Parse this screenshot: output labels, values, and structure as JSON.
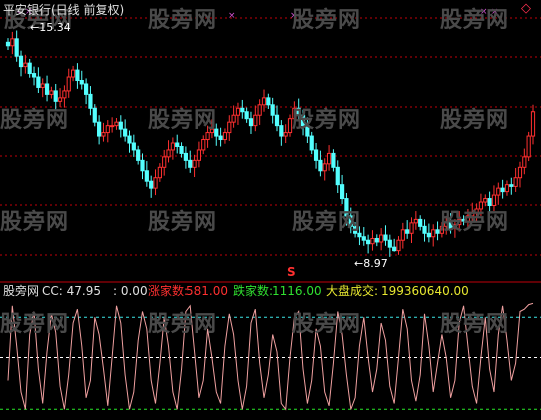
{
  "header": {
    "title": "平安银行(日线 前复权)",
    "high_label": "15.34",
    "low_label": "8.97",
    "sell_mark": "S",
    "diamond_icon": "diamond-outline-icon"
  },
  "indicator_bar": {
    "name": "股旁网",
    "cc_label": "CC: 47.95",
    "zero_label": ": 0.00",
    "up_label": "涨家数:",
    "up_value": "581.00",
    "down_label": "跌家数:",
    "down_value": "1116.00",
    "vol_label": "大盘成交:",
    "vol_value": "199360640.00"
  },
  "watermark": "股旁网",
  "colors": {
    "up_candle": "#ff3030",
    "down_candle": "#54ffff",
    "ref_line": "#c0000a",
    "osc_line": "#f0a0a0",
    "upper_band": "#3ce6e6",
    "lower_band": "#28e628",
    "mid_band": "#ffffff"
  },
  "chart_data": [
    {
      "type": "candlestick",
      "title": "平安银行(日线 前复权)",
      "ylim": [
        8.5,
        15.7
      ],
      "grid": true,
      "high": 15.34,
      "low": 8.97,
      "closes": [
        14.9,
        15.1,
        14.6,
        14.3,
        14.4,
        14.1,
        14.0,
        13.7,
        13.8,
        13.5,
        13.6,
        13.3,
        13.4,
        13.6,
        14.0,
        14.2,
        13.9,
        13.8,
        13.5,
        13.1,
        12.7,
        12.3,
        12.4,
        12.6,
        12.6,
        12.7,
        12.5,
        12.3,
        12.1,
        11.9,
        11.6,
        11.3,
        11.0,
        10.8,
        11.1,
        11.4,
        11.7,
        11.9,
        12.1,
        12.0,
        11.8,
        11.6,
        11.4,
        11.6,
        11.9,
        12.2,
        12.4,
        12.5,
        12.3,
        12.2,
        12.4,
        12.7,
        12.9,
        13.1,
        13.0,
        12.8,
        12.6,
        12.9,
        13.2,
        13.4,
        13.2,
        12.9,
        12.6,
        12.3,
        12.4,
        12.8,
        13.1,
        12.9,
        12.6,
        12.3,
        11.9,
        11.6,
        11.3,
        11.5,
        11.8,
        11.4,
        10.9,
        10.5,
        10.0,
        9.7,
        9.5,
        9.4,
        9.3,
        9.2,
        9.35,
        9.25,
        9.45,
        9.3,
        9.1,
        9.0,
        9.3,
        9.6,
        9.5,
        9.8,
        9.9,
        9.7,
        9.5,
        9.4,
        9.6,
        9.5,
        9.7,
        9.8,
        9.65,
        9.75,
        9.9,
        9.85,
        10.0,
        10.1,
        10.2,
        10.4,
        10.5,
        10.3,
        10.6,
        10.8,
        10.7,
        10.9,
        10.85,
        11.1,
        11.4,
        11.7,
        12.3,
        13.0
      ],
      "annotations": [
        "15.34",
        "8.97",
        "S"
      ]
    },
    {
      "type": "line",
      "title": "股旁网",
      "series": [
        {
          "name": "CC",
          "values": [
            30,
            95,
            60,
            20,
            5,
            70,
            90,
            40,
            10,
            55,
            88,
            72,
            25,
            5,
            35,
            80,
            92,
            60,
            15,
            30,
            85,
            70,
            40,
            8,
            50,
            95,
            80,
            35,
            5,
            20,
            65,
            90,
            75,
            30,
            10,
            45,
            85,
            60,
            20,
            5,
            40,
            90,
            95,
            55,
            15,
            30,
            75,
            50,
            20,
            10,
            60,
            88,
            70,
            30,
            5,
            25,
            80,
            92,
            45,
            15,
            35,
            70,
            55,
            10,
            5,
            50,
            85,
            90,
            40,
            10,
            30,
            75,
            60,
            20,
            8,
            45,
            90,
            70,
            35,
            5,
            15,
            60,
            85,
            50,
            20,
            40,
            80,
            65,
            25,
            10,
            50,
            92,
            75,
            30,
            12,
            35,
            88,
            60,
            20,
            45,
            70,
            50,
            15,
            30,
            80,
            95,
            60,
            25,
            10,
            50,
            85,
            40,
            20,
            70,
            95,
            65,
            30,
            45,
            90,
            92,
            96,
            97
          ]
        }
      ],
      "bands": {
        "upper": 85,
        "middle": 50,
        "lower": 5
      },
      "ylim": [
        0,
        100
      ]
    }
  ]
}
